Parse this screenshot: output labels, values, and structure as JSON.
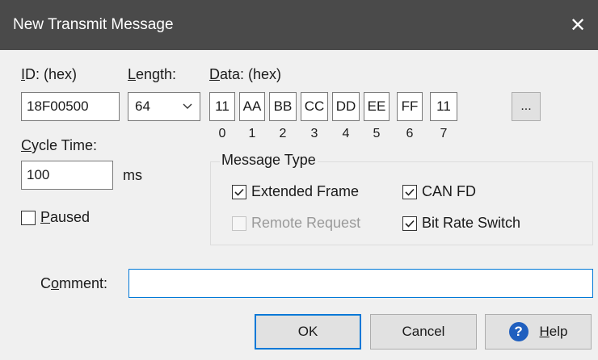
{
  "window": {
    "title": "New Transmit Message",
    "close_glyph": "✕"
  },
  "id_field": {
    "label_accel": "I",
    "label_rest": "D: (hex)",
    "value": "18F00500"
  },
  "length_field": {
    "label_accel": "L",
    "label_rest": "ength:",
    "value": "64"
  },
  "data_field": {
    "label_accel": "D",
    "label_rest": "ata: (hex)",
    "bytes": [
      "11",
      "AA",
      "BB",
      "CC",
      "DD",
      "EE",
      "FF",
      "11"
    ],
    "indices": [
      "0",
      "1",
      "2",
      "3",
      "4",
      "5",
      "6",
      "7"
    ],
    "more_label": "..."
  },
  "cycle_time": {
    "label_accel": "C",
    "label_rest": "ycle Time:",
    "value": "100",
    "unit": "ms"
  },
  "paused": {
    "label_accel": "P",
    "label_rest": "aused",
    "checked": false
  },
  "message_type": {
    "legend": "Message Type",
    "extended_frame": {
      "label": "Extended Frame",
      "checked": true
    },
    "can_fd": {
      "label": "CAN FD",
      "checked": true
    },
    "remote_request": {
      "label": "Remote Request",
      "checked": false,
      "disabled": true
    },
    "bit_rate_switch": {
      "label": "Bit Rate Switch",
      "checked": true
    }
  },
  "comment": {
    "label_pre": "C",
    "label_accel": "o",
    "label_rest": "mment:",
    "value": ""
  },
  "buttons": {
    "ok": "OK",
    "cancel": "Cancel",
    "help_accel": "H",
    "help_rest": "elp",
    "help_icon": "?"
  },
  "colors": {
    "accent": "#0078d7",
    "titlebar": "#4a4a4a",
    "help_icon_bg": "#1f5fbf"
  }
}
